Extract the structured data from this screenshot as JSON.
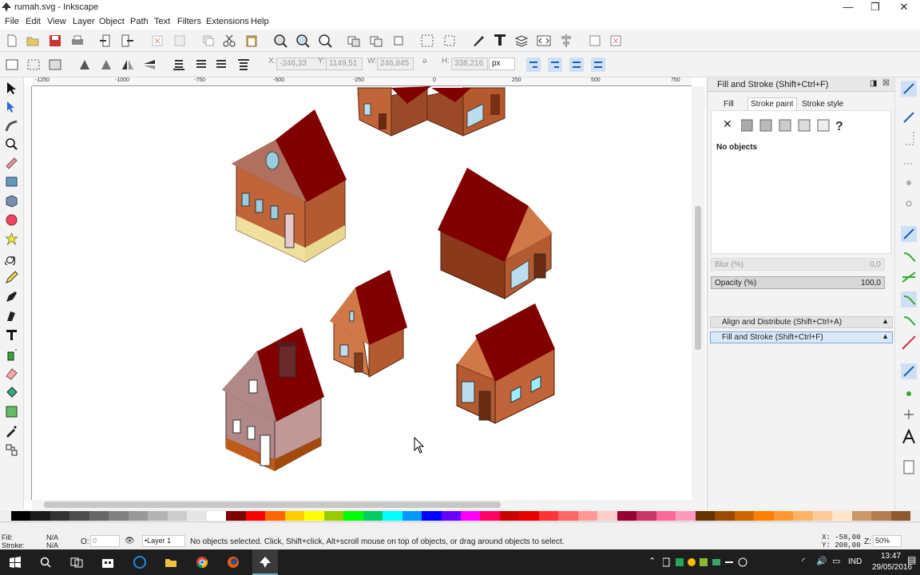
{
  "window": {
    "title": "rumah.svg - Inkscape",
    "min": "—",
    "max": "❐",
    "close": "✕"
  },
  "menu": [
    "File",
    "Edit",
    "View",
    "Layer",
    "Object",
    "Path",
    "Text",
    "Filters",
    "Extensions",
    "Help"
  ],
  "toolbar2": {
    "x_label": "X:",
    "x_value": "-246,33",
    "y_label": "Y:",
    "y_value": "1149,51",
    "w_label": "W:",
    "w_value": "246,845",
    "h_label": "H:",
    "h_value": "338,216",
    "unit": "px"
  },
  "ruler": {
    "labels": [
      "-1250",
      "-1000",
      "-750",
      "-500",
      "-250",
      "0",
      "250",
      "500",
      "750"
    ]
  },
  "dock": {
    "panel_title": "Fill and Stroke (Shift+Ctrl+F)",
    "tabs": [
      "Fill",
      "Stroke paint",
      "Stroke style"
    ],
    "no_objects": "No objects",
    "blur_label": "Blur (%)",
    "blur_value": "0,0",
    "opacity_label": "Opacity (%)",
    "opacity_value": "100,0",
    "collapsed": [
      "Align and Distribute (Shift+Ctrl+A)",
      "Fill and Stroke (Shift+Ctrl+F)"
    ]
  },
  "status": {
    "fill_label": "Fill:",
    "fill_value": "N/A",
    "stroke_label": "Stroke:",
    "stroke_value": "N/A",
    "o_label": "O:",
    "o_value": "0",
    "layer": "•Layer 1",
    "message": "No objects selected. Click, Shift+click, Alt+scroll mouse on top of objects, or drag around objects to select.",
    "x_coord": "X: -58,00",
    "y_coord": "Y: 208,00",
    "zoom_label": "Z:",
    "zoom": "50%"
  },
  "taskbar": {
    "lang": "IND",
    "time": "13:47",
    "date": "29/05/2016"
  },
  "colors": {
    "roof": "#800000",
    "wall": "#c0643a",
    "accent": "#3399ff"
  }
}
